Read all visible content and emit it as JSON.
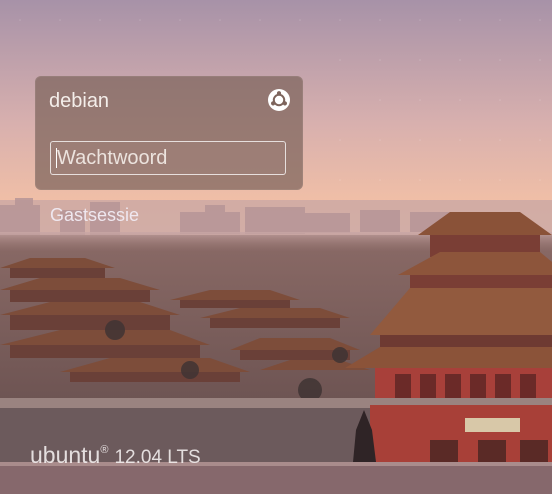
{
  "login": {
    "username": "debian",
    "password_placeholder": "Wachtwoord",
    "password_value": "",
    "session_icon": "ubuntu-logo-icon"
  },
  "guest": {
    "label": "Gastsessie"
  },
  "branding": {
    "name": "ubuntu",
    "registered": "®",
    "version": "12.04 LTS"
  },
  "colors": {
    "sky_top": "#a48fa6",
    "sky_glow": "#f3c0a8",
    "panel": "#7d645c",
    "wall_red": "#a8403a",
    "roof_brown": "#7a4a34"
  }
}
